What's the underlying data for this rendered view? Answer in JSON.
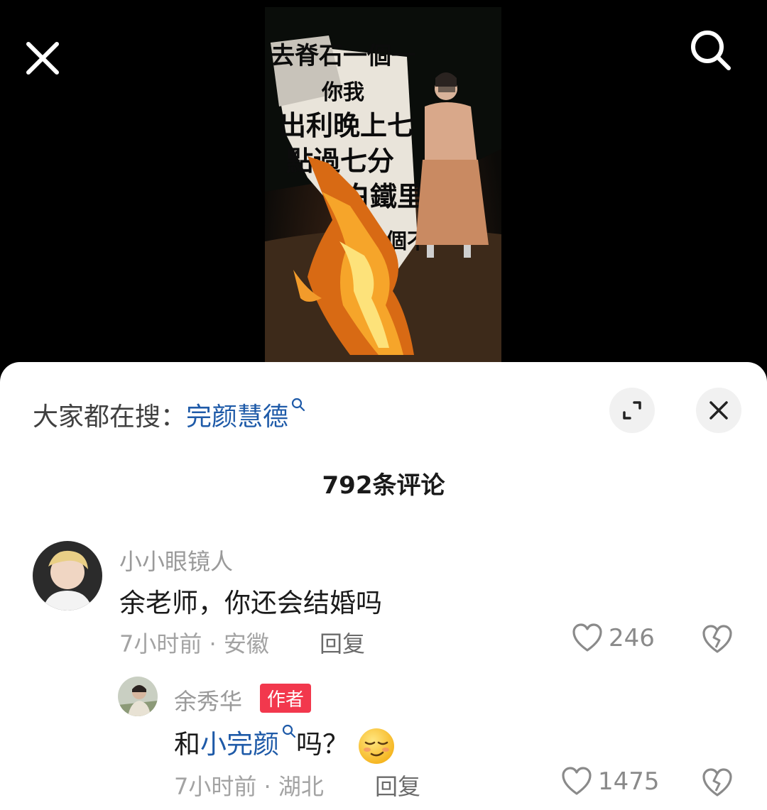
{
  "video": {
    "close_icon": "close-icon",
    "search_icon": "search-icon",
    "banner_text": [
      "去脊石一個一",
      "你我",
      "出利晚上七",
      "點過七分",
      "白鐵里",
      "個不"
    ]
  },
  "sheet": {
    "trending_prefix": "大家都在搜：",
    "trending_keyword": "完颜慧德",
    "comment_count": "792条评论",
    "expand_icon": "expand-icon",
    "close_icon": "close-icon"
  },
  "comments": [
    {
      "username": "小小眼镜人",
      "text": "余老师，你还会结婚吗",
      "meta": "7小时前 · 安徽",
      "reply_label": "回复",
      "likes": "246"
    }
  ],
  "replies": [
    {
      "username": "余秀华",
      "badge": "作者",
      "text_before": "和",
      "text_keyword": "小完颜",
      "text_after": "吗？",
      "emoji": "smug-face-emoji",
      "meta": "7小时前 · 湖北",
      "reply_label": "回复",
      "likes": "1475"
    }
  ]
}
